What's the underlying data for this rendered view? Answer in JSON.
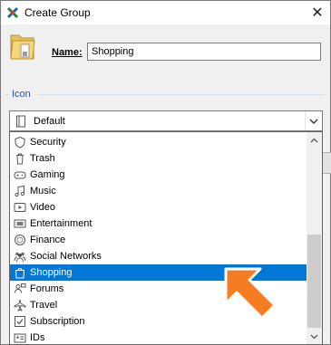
{
  "window": {
    "title": "Create Group"
  },
  "name_field": {
    "label": "Name:",
    "value": "Shopping"
  },
  "icon_group": {
    "label": "Icon"
  },
  "combo": {
    "selected": "Default"
  },
  "dropdown_items": [
    {
      "label": "Security",
      "icon": "shield-icon"
    },
    {
      "label": "Trash",
      "icon": "trash-icon"
    },
    {
      "label": "Gaming",
      "icon": "gamepad-icon"
    },
    {
      "label": "Music",
      "icon": "music-note-icon"
    },
    {
      "label": "Video",
      "icon": "video-play-icon"
    },
    {
      "label": "Entertainment",
      "icon": "ticket-icon"
    },
    {
      "label": "Finance",
      "icon": "coin-icon"
    },
    {
      "label": "Social Networks",
      "icon": "people-icon"
    },
    {
      "label": "Shopping",
      "icon": "shopping-bag-icon",
      "selected": true
    },
    {
      "label": "Forums",
      "icon": "forum-icon"
    },
    {
      "label": "Travel",
      "icon": "airplane-icon"
    },
    {
      "label": "Subscription",
      "icon": "checkbox-icon"
    },
    {
      "label": "IDs",
      "icon": "id-card-icon"
    }
  ],
  "colors": {
    "selection": "#0078d7",
    "accent_arrow": "#f57c20",
    "group_label": "#2b5797"
  }
}
